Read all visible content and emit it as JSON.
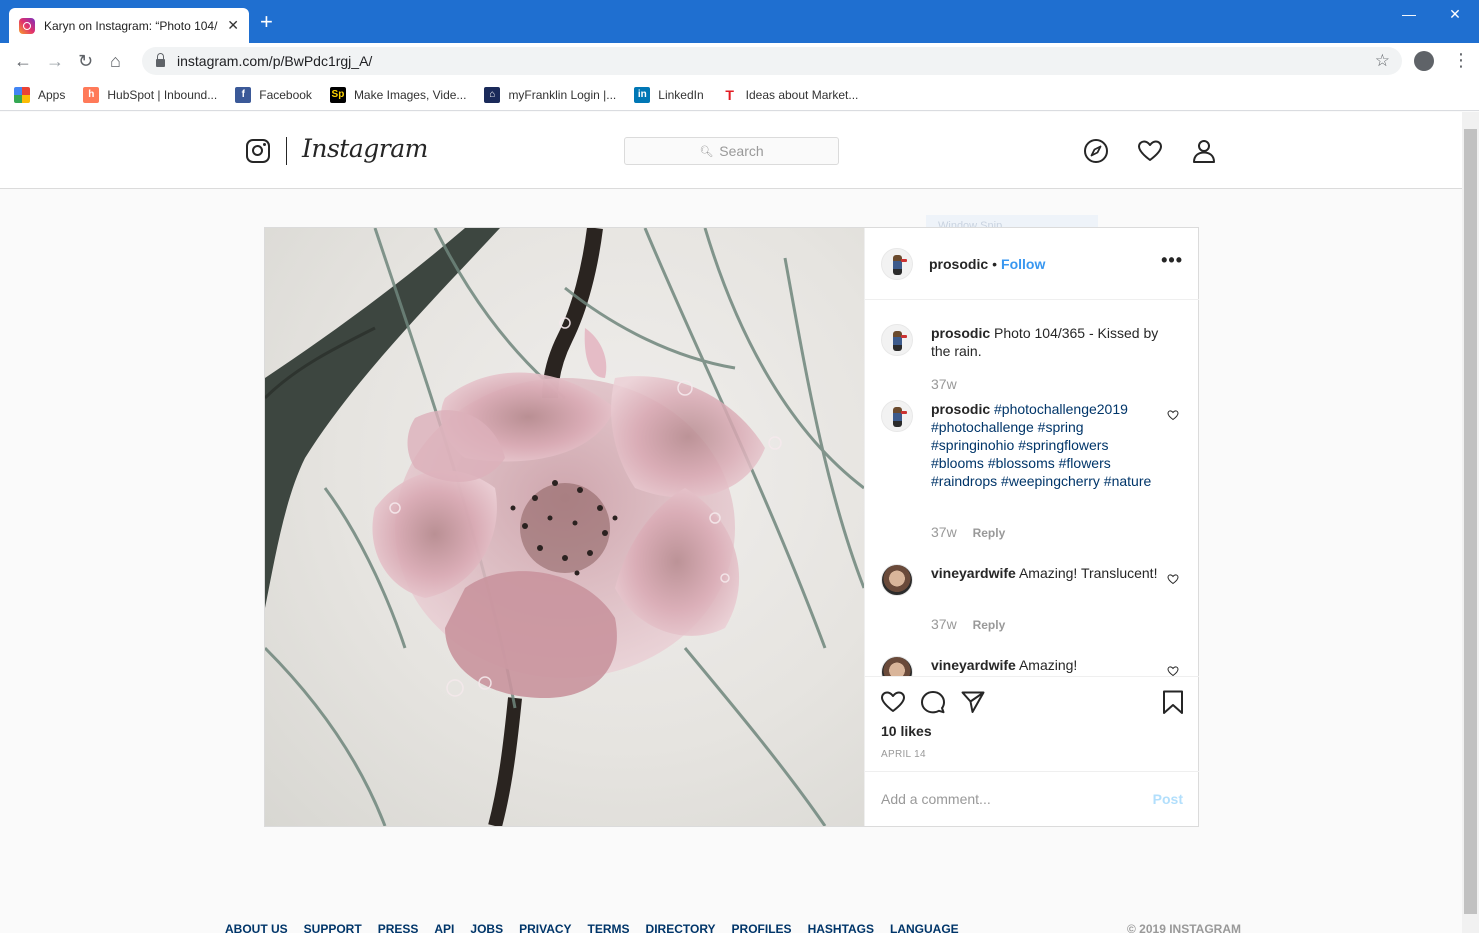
{
  "browser": {
    "tab_title": "Karyn on Instagram: “Photo 104/",
    "tab_close": "✕",
    "new_tab": "+",
    "url": "instagram.com/p/BwPdc1rgj_A/",
    "window_controls": {
      "minimize": "—",
      "maximize": "☐",
      "close": "✕"
    },
    "bookmarks": [
      {
        "label": "Apps",
        "icon": "apps-grid-icon",
        "color": "#ea4335"
      },
      {
        "label": "HubSpot | Inbound...",
        "icon": "hubspot-icon",
        "color": "#ff7a59"
      },
      {
        "label": "Facebook",
        "icon": "facebook-icon",
        "color": "#3b5998"
      },
      {
        "label": "Make Images, Vide...",
        "icon": "spark-icon",
        "color": "#000000"
      },
      {
        "label": "myFranklin Login |...",
        "icon": "franklin-icon",
        "color": "#1a2a5a"
      },
      {
        "label": "LinkedIn",
        "icon": "linkedin-icon",
        "color": "#0077b5"
      },
      {
        "label": "Ideas about Market...",
        "icon": "t-icon",
        "color": "#e31c23"
      }
    ]
  },
  "instagram": {
    "wordmark": "Instagram",
    "search_placeholder": "Search",
    "post": {
      "username": "prosodic",
      "separator": "•",
      "follow_label": "Follow",
      "more": "•••",
      "caption": {
        "username": "prosodic",
        "text": "Photo 104/365 - Kissed by the rain.",
        "time": "37w"
      },
      "comments": [
        {
          "username": "prosodic",
          "tags": [
            "#photochallenge2019",
            "#photochallenge",
            "#spring",
            "#springinohio",
            "#springflowers",
            "#blooms",
            "#blossoms",
            "#flowers",
            "#raindrops",
            "#weepingcherry",
            "#nature"
          ],
          "time": "37w",
          "reply": "Reply"
        },
        {
          "username": "vineyardwife",
          "text": "Amazing! Translucent!",
          "time": "37w",
          "reply": "Reply"
        },
        {
          "username": "vineyardwife",
          "text": "Amazing!"
        }
      ],
      "likes": "10 likes",
      "date": "APRIL 14",
      "comment_placeholder": "Add a comment...",
      "post_button": "Post"
    },
    "overlay_text": "Window Snip",
    "footer": [
      "ABOUT US",
      "SUPPORT",
      "PRESS",
      "API",
      "JOBS",
      "PRIVACY",
      "TERMS",
      "DIRECTORY",
      "PROFILES",
      "HASHTAGS",
      "LANGUAGE"
    ],
    "copyright": "© 2019 INSTAGRAM"
  },
  "colors": {
    "chrome_blue": "#1f6fd0",
    "link_blue": "#3897f0",
    "hashtag": "#003569"
  }
}
